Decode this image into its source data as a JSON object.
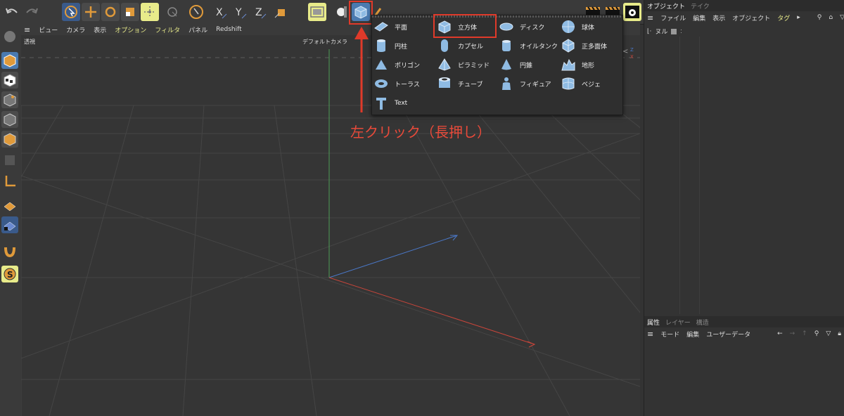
{
  "toolbar": {
    "undo": "undo-icon",
    "redo": "redo-icon"
  },
  "viewport_menu": {
    "items": [
      "ビュー",
      "カメラ",
      "表示",
      "オプション",
      "フィルタ",
      "パネル",
      "Redshift"
    ]
  },
  "viewport": {
    "mode_label": "透視",
    "camera_label": "デフォルトカメラ"
  },
  "popup": {
    "items": [
      {
        "label": "平面",
        "icon": "plane-icon"
      },
      {
        "label": "円柱",
        "icon": "cylinder-icon"
      },
      {
        "label": "ポリゴン",
        "icon": "polygon-icon"
      },
      {
        "label": "トーラス",
        "icon": "torus-icon"
      },
      {
        "label": "Text",
        "icon": "text-icon"
      },
      {
        "label": "立方体",
        "icon": "cube-icon"
      },
      {
        "label": "カプセル",
        "icon": "capsule-icon"
      },
      {
        "label": "ピラミッド",
        "icon": "pyramid-icon"
      },
      {
        "label": "チューブ",
        "icon": "tube-icon"
      },
      {
        "label": "ディスク",
        "icon": "disc-icon"
      },
      {
        "label": "オイルタンク",
        "icon": "oil-tank-icon"
      },
      {
        "label": "円錐",
        "icon": "cone-icon"
      },
      {
        "label": "フィギュア",
        "icon": "figure-icon"
      },
      {
        "label": "球体",
        "icon": "sphere-icon"
      },
      {
        "label": "正多面体",
        "icon": "platonic-icon"
      },
      {
        "label": "地形",
        "icon": "landscape-icon"
      },
      {
        "label": "ベジェ",
        "icon": "bezier-icon"
      }
    ]
  },
  "annotation": "左クリック（長押し）",
  "object_panel": {
    "tabs": [
      "オブジェクト",
      "テイク"
    ],
    "menu": [
      "ファイル",
      "編集",
      "表示",
      "オブジェクト",
      "タグ"
    ],
    "null_label": "ヌル"
  },
  "attr_panel": {
    "tabs": [
      "属性",
      "レイヤー",
      "構造"
    ],
    "menu": [
      "モード",
      "編集",
      "ユーザーデータ"
    ]
  },
  "colors": {
    "accent": "#e8eb8a",
    "highlight": "#e03a2a",
    "panel": "#333333"
  }
}
